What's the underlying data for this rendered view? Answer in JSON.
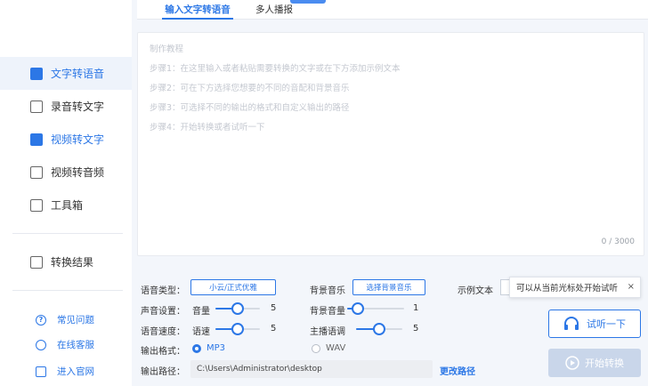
{
  "sidebar": {
    "items": [
      {
        "label": "文字转语音",
        "icon": "text-to-speech-icon"
      },
      {
        "label": "录音转文字",
        "icon": "recording-icon"
      },
      {
        "label": "视频转文字",
        "icon": "video-text-icon"
      },
      {
        "label": "视频转音频",
        "icon": "video-audio-icon"
      },
      {
        "label": "工具箱",
        "icon": "toolbox-icon"
      },
      {
        "label": "转换结果",
        "icon": "result-icon"
      }
    ],
    "footer": [
      {
        "label": "常见问题",
        "icon": "help-icon"
      },
      {
        "label": "在线客服",
        "icon": "headset-icon"
      },
      {
        "label": "进入官网",
        "icon": "monitor-icon"
      }
    ]
  },
  "tabs": [
    {
      "label": "输入文字转语音"
    },
    {
      "label": "多人播报"
    }
  ],
  "editor": {
    "lines": [
      "制作教程",
      "步骤1：在这里输入或者粘贴需要转换的文字或在下方添加示例文本",
      "步骤2：可在下方选择您想要的不同的音配和背景音乐",
      "步骤3：可选择不同的输出的格式和自定义输出的路径",
      "步骤4：开始转换或者试听一下"
    ],
    "counter": "0 / 3000"
  },
  "settings": {
    "voice_type_label": "语音类型：",
    "voice_type_value": "小云/正式优雅",
    "bg_music_label": "背景音乐",
    "bg_music_button": "选择背景音乐",
    "example_text_label": "示例文本",
    "sound_settings_label": "声音设置：",
    "volume_label": "音量",
    "volume_value": "5",
    "bg_volume_label": "背景音量",
    "bg_volume_value": "1",
    "speed_label": "语音速度：",
    "speed_sub_label": "语速",
    "speed_value": "5",
    "pitch_label": "主播语调",
    "pitch_value": "5",
    "format_label": "输出格式：",
    "format_options": [
      "MP3",
      "WAV"
    ],
    "format_selected": "MP3",
    "path_label": "输出路径：",
    "path_value": "C:\\Users\\Administrator\\desktop",
    "change_path": "更改路径"
  },
  "tooltip": {
    "text": "可以从当前光标处开始试听",
    "close": "×"
  },
  "actions": {
    "listen": "试听一下",
    "start": "开始转换"
  },
  "colors": {
    "accent": "#2c77e6",
    "disabled": "#c9d6ea"
  }
}
